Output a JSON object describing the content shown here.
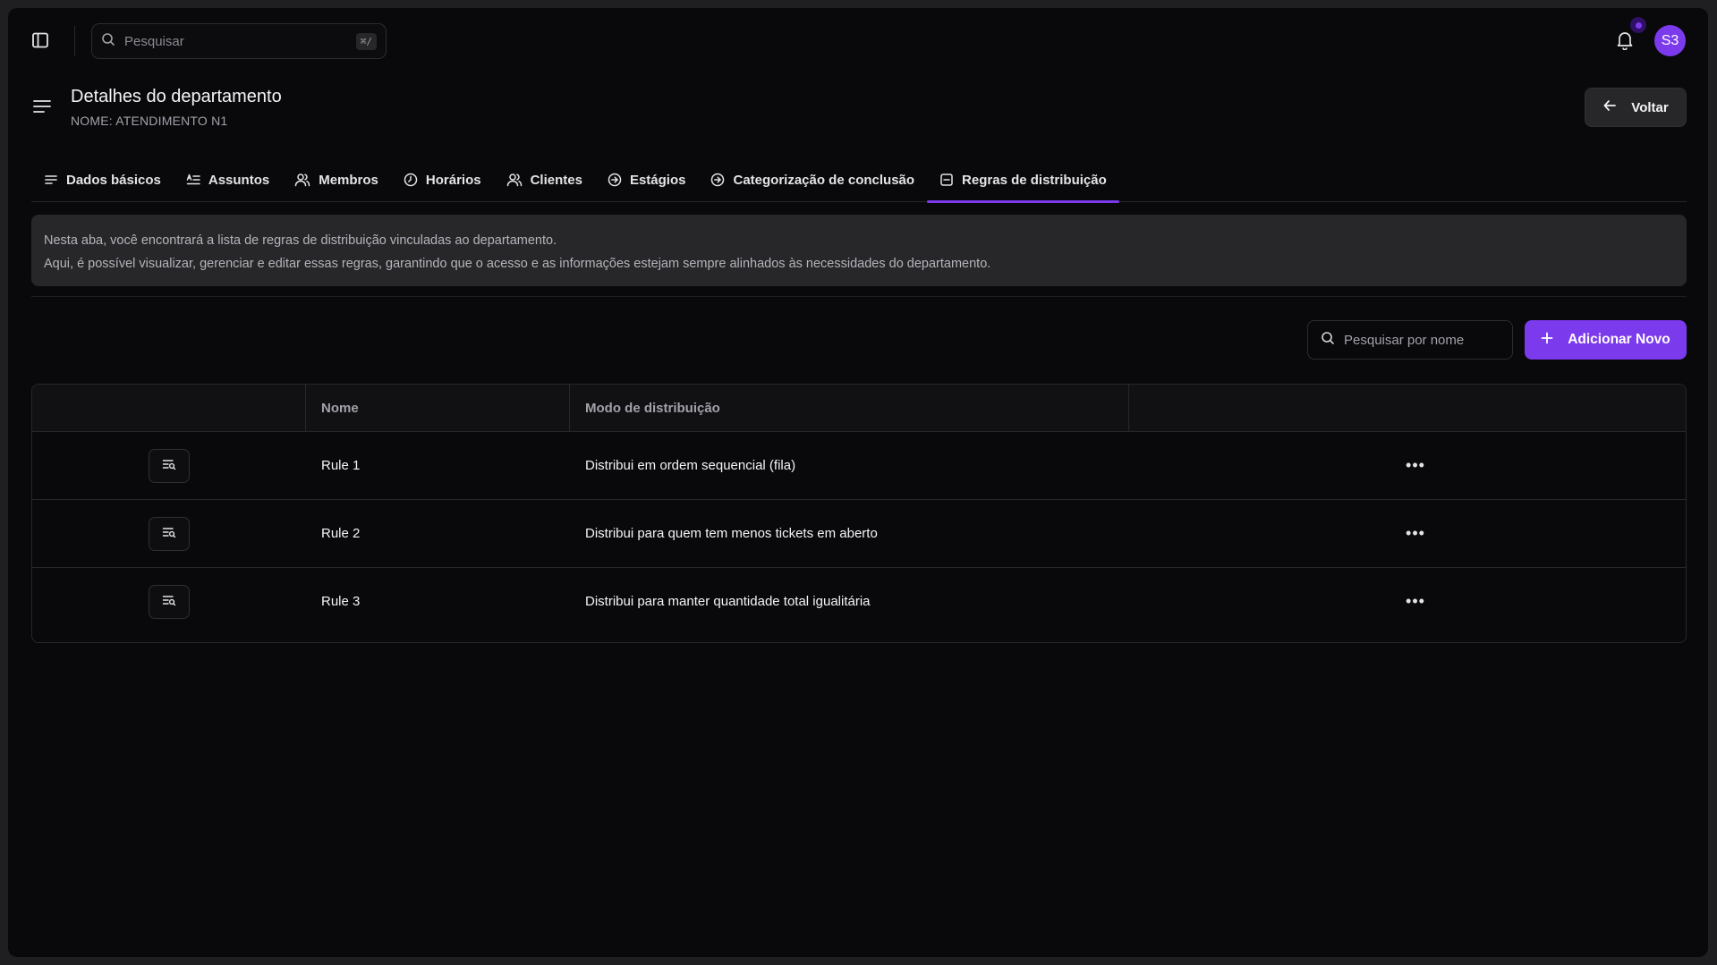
{
  "topbar": {
    "search_placeholder": "Pesquisar",
    "shortcut": "⌘/",
    "avatar_initials": "S3"
  },
  "header": {
    "title": "Detalhes do departamento",
    "subtitle": "NOME: ATENDIMENTO N1",
    "back_label": "Voltar"
  },
  "tabs": [
    {
      "label": "Dados básicos",
      "icon": "lines-icon"
    },
    {
      "label": "Assuntos",
      "icon": "text-list-icon"
    },
    {
      "label": "Membros",
      "icon": "users-icon"
    },
    {
      "label": "Horários",
      "icon": "clock-icon"
    },
    {
      "label": "Clientes",
      "icon": "users-icon"
    },
    {
      "label": "Estágios",
      "icon": "arrow-circle-icon"
    },
    {
      "label": "Categorização de conclusão",
      "icon": "arrow-circle-icon"
    },
    {
      "label": "Regras de distribuição",
      "icon": "square-minus-icon",
      "active": true
    }
  ],
  "info": {
    "line1": "Nesta aba, você encontrará a lista de regras de distribuição vinculadas ao departamento.",
    "line2": "Aqui, é possível visualizar, gerenciar e editar essas regras, garantindo que o acesso e as informações estejam sempre alinhados às necessidades do departamento."
  },
  "toolbar": {
    "search_placeholder": "Pesquisar por nome",
    "add_label": "Adicionar Novo"
  },
  "table": {
    "columns": [
      "",
      "Nome",
      "Modo de distribuição",
      ""
    ],
    "rows": [
      {
        "name": "Rule 1",
        "mode": "Distribui em ordem sequencial (fila)"
      },
      {
        "name": "Rule 2",
        "mode": "Distribui para quem tem menos tickets em aberto"
      },
      {
        "name": "Rule 3",
        "mode": "Distribui para manter quantidade total igualitária"
      }
    ]
  },
  "colors": {
    "accent": "#7c3aed",
    "background": "#09090b",
    "surface": "#27272a"
  }
}
